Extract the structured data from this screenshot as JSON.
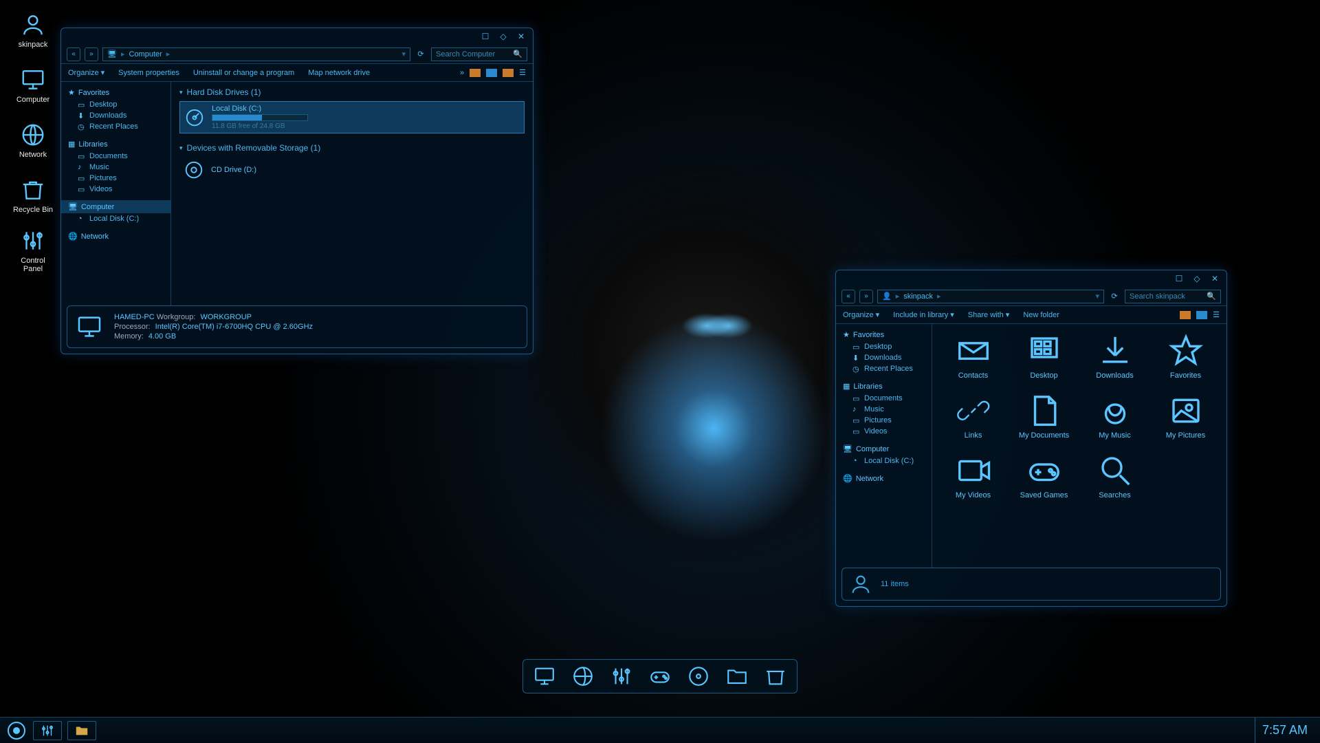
{
  "desktop_icons": [
    {
      "id": "skinpack",
      "label": "skinpack"
    },
    {
      "id": "computer",
      "label": "Computer"
    },
    {
      "id": "network",
      "label": "Network"
    },
    {
      "id": "recycle-bin",
      "label": "Recycle Bin"
    },
    {
      "id": "control-panel",
      "label": "Control\nPanel"
    }
  ],
  "win1": {
    "breadcrumb": [
      "Computer"
    ],
    "search_placeholder": "Search Computer",
    "toolbar": {
      "organize": "Organize",
      "sysprops": "System properties",
      "uninstall": "Uninstall or change a program",
      "mapdrive": "Map network drive"
    },
    "sidebar": {
      "favorites": {
        "hdr": "Favorites",
        "items": [
          "Desktop",
          "Downloads",
          "Recent Places"
        ]
      },
      "libraries": {
        "hdr": "Libraries",
        "items": [
          "Documents",
          "Music",
          "Pictures",
          "Videos"
        ]
      },
      "computer": {
        "hdr": "Computer",
        "items": [
          "Local Disk (C:)"
        ]
      },
      "network": {
        "hdr": "Network"
      }
    },
    "sections": {
      "hdd": {
        "title": "Hard Disk Drives (1)",
        "drive": {
          "name": "Local Disk (C:)",
          "free": "11.8 GB free of 24.8 GB",
          "pct": 52
        }
      },
      "removable": {
        "title": "Devices with Removable Storage (1)",
        "drive": {
          "name": "CD Drive (D:)"
        }
      }
    },
    "details": {
      "name": "HAMED-PC",
      "workgroup_l": "Workgroup:",
      "workgroup_v": "WORKGROUP",
      "proc_l": "Processor:",
      "proc_v": "Intel(R) Core(TM) i7-6700HQ CPU @ 2.60GHz",
      "mem_l": "Memory:",
      "mem_v": "4.00 GB"
    }
  },
  "win2": {
    "breadcrumb": [
      "skinpack"
    ],
    "search_placeholder": "Search skinpack",
    "toolbar": {
      "organize": "Organize",
      "include": "Include in library",
      "share": "Share with",
      "newfolder": "New folder"
    },
    "sidebar": {
      "favorites": {
        "hdr": "Favorites",
        "items": [
          "Desktop",
          "Downloads",
          "Recent Places"
        ]
      },
      "libraries": {
        "hdr": "Libraries",
        "items": [
          "Documents",
          "Music",
          "Pictures",
          "Videos"
        ]
      },
      "computer": {
        "hdr": "Computer",
        "items": [
          "Local Disk (C:)"
        ]
      },
      "network": {
        "hdr": "Network"
      }
    },
    "grid_items": [
      "Contacts",
      "Desktop",
      "Downloads",
      "Favorites",
      "Links",
      "My Documents",
      "My Music",
      "My Pictures",
      "My Videos",
      "Saved Games",
      "Searches"
    ],
    "details": {
      "count": "11 items"
    }
  },
  "dock": [
    "computer",
    "globe",
    "sliders",
    "gamepad",
    "disk",
    "folder",
    "trash"
  ],
  "taskbar": {
    "clock": "7:57 AM"
  }
}
